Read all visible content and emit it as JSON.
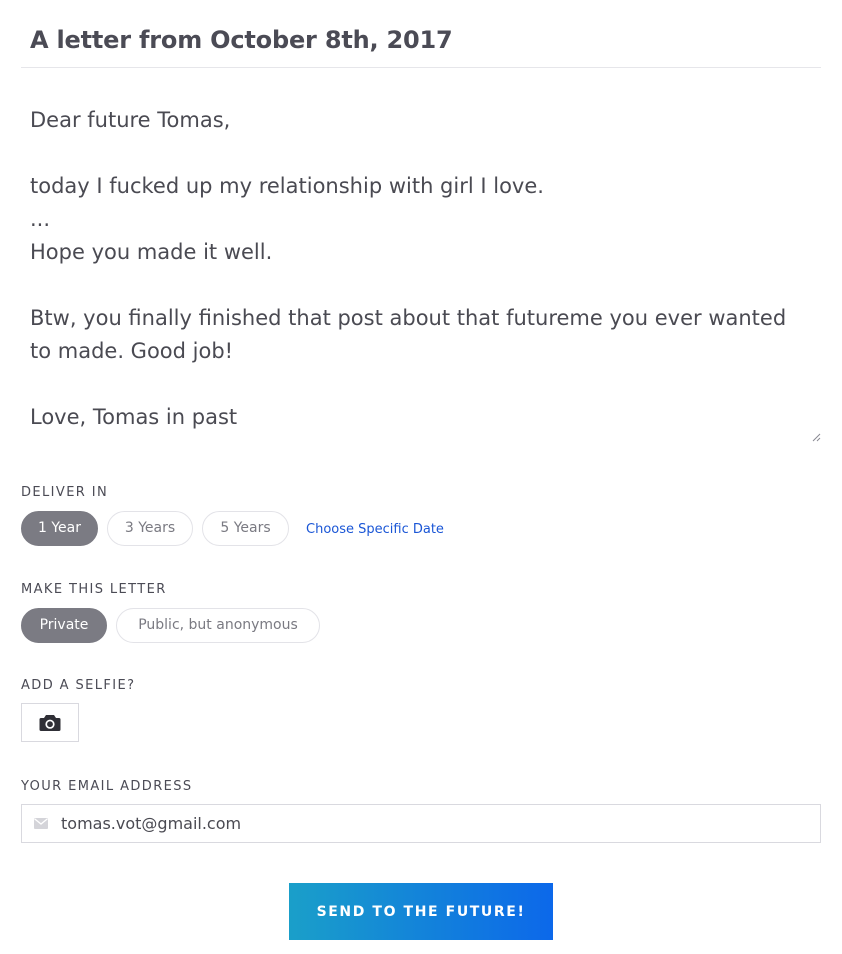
{
  "page": {
    "title": "A letter from October 8th, 2017"
  },
  "letter": {
    "body": "Dear future Tomas,\n\ntoday I fucked up my relationship with girl I love.\n...\nHope you made it well.\n\nBtw, you finally finished that post about that futureme you ever wanted to made. Good job!\n\nLove, Tomas in past"
  },
  "deliver": {
    "label": "DELIVER IN",
    "options": [
      "1 Year",
      "3 Years",
      "5 Years"
    ],
    "selected": "1 Year",
    "specific_date_link": "Choose Specific Date"
  },
  "privacy": {
    "label": "MAKE THIS LETTER",
    "options": [
      "Private",
      "Public, but anonymous"
    ],
    "selected": "Private"
  },
  "selfie": {
    "label": "ADD A SELFIE?",
    "icon": "camera-icon"
  },
  "email": {
    "label": "YOUR EMAIL ADDRESS",
    "value": "tomas.vot@gmail.com",
    "icon": "envelope-icon"
  },
  "submit": {
    "label": "SEND TO THE FUTURE!"
  },
  "colors": {
    "accent_gradient_start": "#1a9fc9",
    "accent_gradient_end": "#0c68ea",
    "active_pill": "#7b7b83",
    "link": "#1a56d6"
  }
}
